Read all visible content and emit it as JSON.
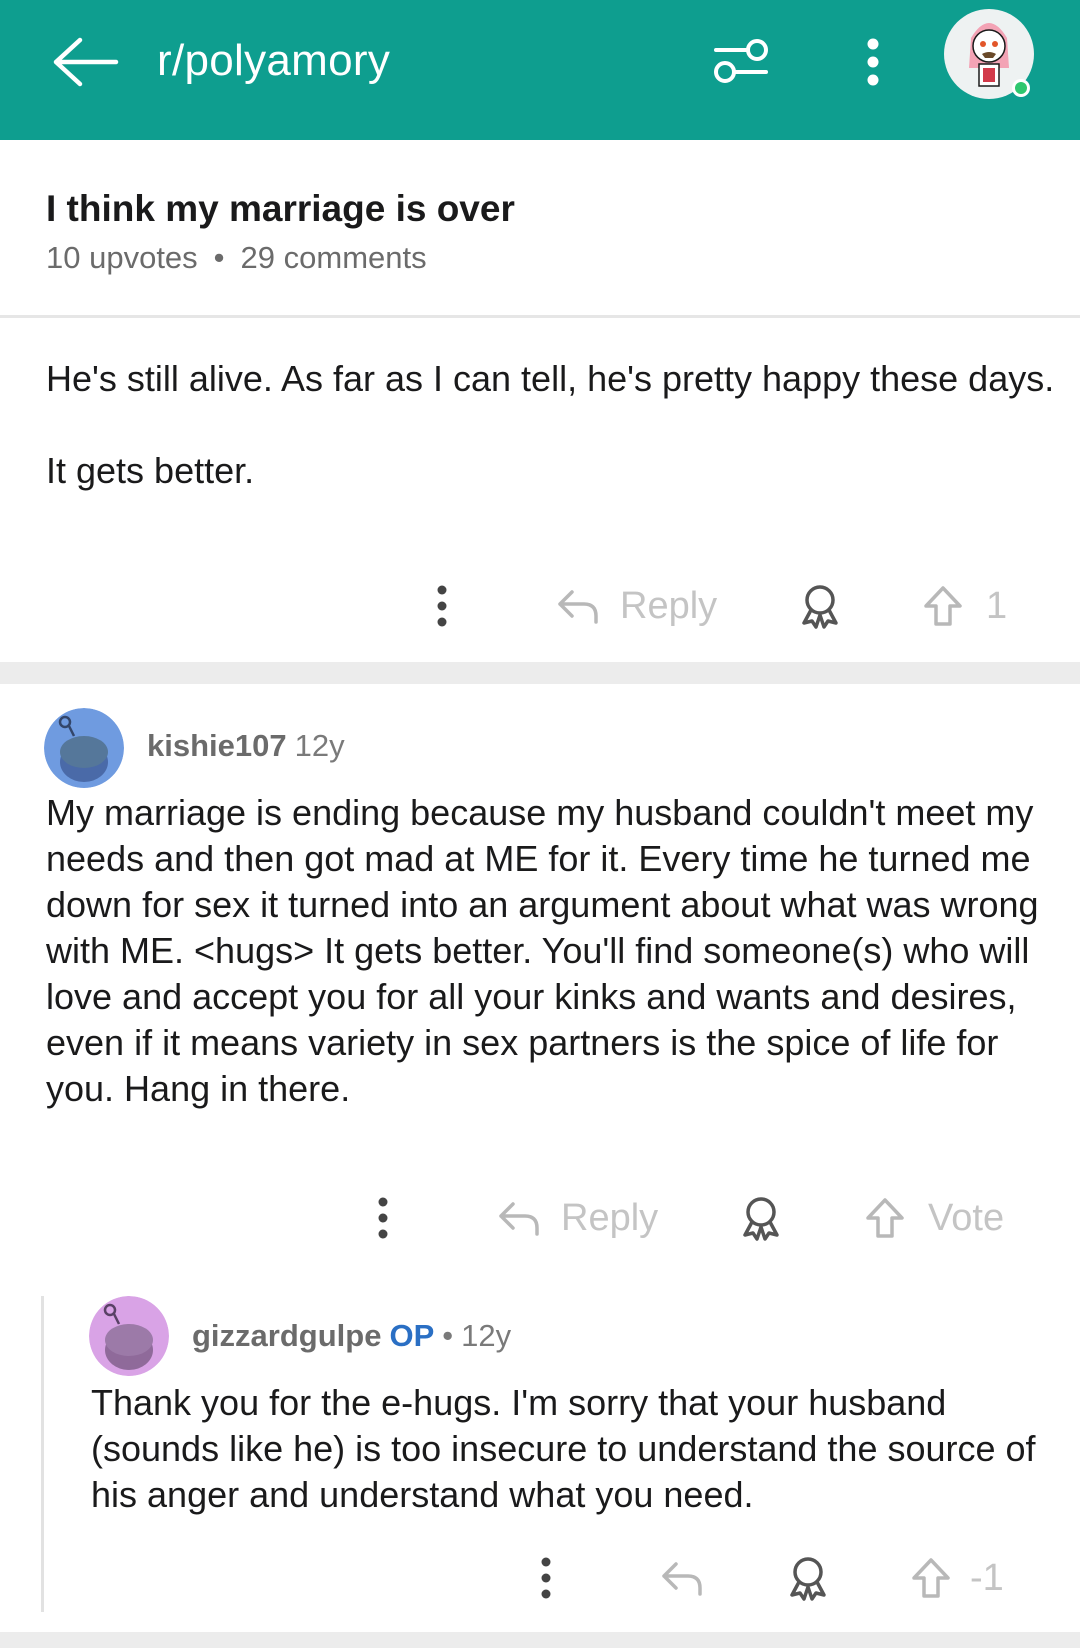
{
  "header": {
    "subreddit": "r/polyamory",
    "accent_color": "#0e9e8f",
    "icons": [
      "back-arrow-icon",
      "filter-icon",
      "more-vertical-icon",
      "avatar"
    ]
  },
  "post": {
    "title": "I think my marriage is over",
    "upvotes": "10 upvotes",
    "separator": "•",
    "comments": "29 comments"
  },
  "comments": [
    {
      "paragraphs": [
        "He's still alive.  As far as I can tell, he's pretty happy these days.",
        "It gets better."
      ],
      "reply_label": "Reply",
      "vote_label": "1"
    },
    {
      "username": "kishie107",
      "age": "12y",
      "body": "My marriage is ending because my husband couldn't meet my needs and then got mad at ME for it. Every time he turned me down for sex it turned into an argument about what was wrong with ME. <hugs> It gets better. You'll find someone(s) who will love and accept you for all your kinks and wants and desires, even if it means variety in sex partners is the spice of life for you. Hang in there.",
      "reply_label": "Reply",
      "vote_label": "Vote",
      "avatar_color": "#6f9be0"
    },
    {
      "username": "gizzardgulpe",
      "op_badge": "OP",
      "separator": "•",
      "age": "12y",
      "body": "Thank you for the e-hugs. I'm sorry that your husband (sounds like he) is too insecure to understand the source of his anger and understand what you need.",
      "vote_label": "-1",
      "avatar_color": "#d9a3e6"
    }
  ]
}
